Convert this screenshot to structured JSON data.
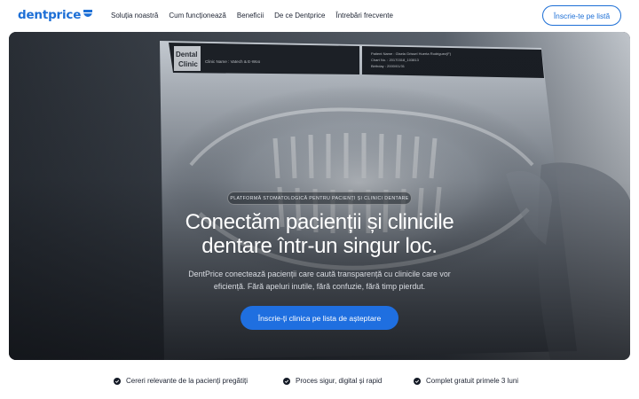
{
  "brand": {
    "name": "dentprice",
    "color": "#1d6fd6"
  },
  "nav": {
    "links": [
      {
        "label": "Soluția noastră"
      },
      {
        "label": "Cum funcționează"
      },
      {
        "label": "Beneficii"
      },
      {
        "label": "De ce Dentprice"
      },
      {
        "label": "Întrebări frecvente"
      }
    ],
    "cta_label": "Înscrie-te pe listă"
  },
  "hero": {
    "badge": "PLATFORMĂ STOMATOLOGICĂ PENTRU PACIENȚI ȘI CLINICI DENTARE",
    "title_line1": "Conectăm pacienții și clinicile",
    "title_line2": "dentare într-un singur loc.",
    "subtitle_line1": "DentPrice conectează pacienții care caută transparență cu clinicile care vor",
    "subtitle_line2": "eficiență. Fără apeluri inutile, fără confuzie, fără timp pierdut.",
    "cta_label": "Înscrie-ți clinica pe lista de așteptare",
    "cta_color": "#1f6fe0",
    "photo": {
      "film_header_left": "Dental\nClinic",
      "film_clinic_name": "Clinic Name : Vatech & E-Woo",
      "film_patient_name": "Patient Name : Gisela Grissel Huerta Rodriguez(F)",
      "film_chart_no": "Chart No. : 20170318_103813",
      "film_birthday": "Birthday : 2000/01/31"
    }
  },
  "features": [
    {
      "label": "Cereri relevante de la pacienți pregătiți",
      "icon": "check-circle-icon"
    },
    {
      "label": "Proces sigur, digital și rapid",
      "icon": "check-circle-icon"
    },
    {
      "label": "Complet gratuit primele 3 luni",
      "icon": "check-circle-icon"
    }
  ]
}
